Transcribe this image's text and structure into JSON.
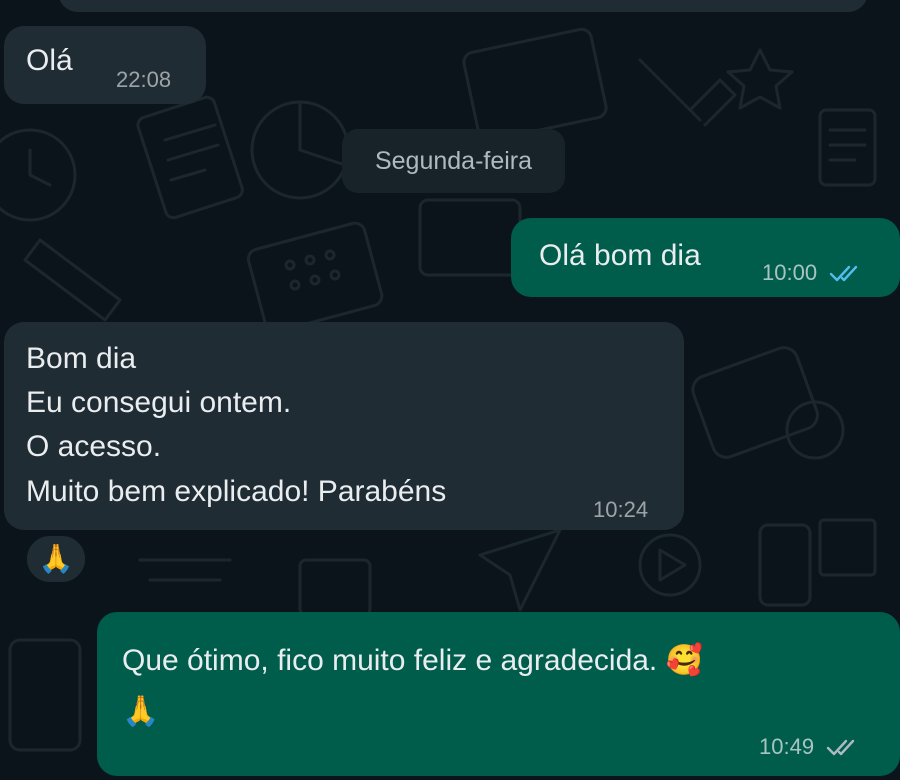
{
  "chat": {
    "day_separator": "Segunda-feira",
    "messages": [
      {
        "id": "m1",
        "direction": "incoming",
        "lines": [
          "Olá"
        ],
        "time": "22:08"
      },
      {
        "id": "m2",
        "direction": "outgoing",
        "lines": [
          "Olá bom dia"
        ],
        "time": "10:00",
        "status": "read"
      },
      {
        "id": "m3",
        "direction": "incoming",
        "lines": [
          "Bom dia",
          "Eu consegui ontem.",
          "O acesso.",
          "Muito bem explicado! Parabéns"
        ],
        "time": "10:24",
        "reaction": "🙏"
      },
      {
        "id": "m4",
        "direction": "outgoing",
        "lines": [
          "Que ótimo, fico muito feliz e agradecida. 🥰",
          "🙏"
        ],
        "time": "10:49",
        "status": "delivered"
      }
    ]
  },
  "icons": {
    "read_ticks": "double-check-icon",
    "delivered_ticks": "double-check-icon",
    "wallpaper": "doodle-wallpaper"
  },
  "colors": {
    "background": "#0b141a",
    "incoming_bubble": "#202c33",
    "outgoing_bubble": "#005c4b",
    "read_tick": "#53bdeb",
    "delivered_tick": "#aebac1",
    "text": "#e9edef"
  }
}
